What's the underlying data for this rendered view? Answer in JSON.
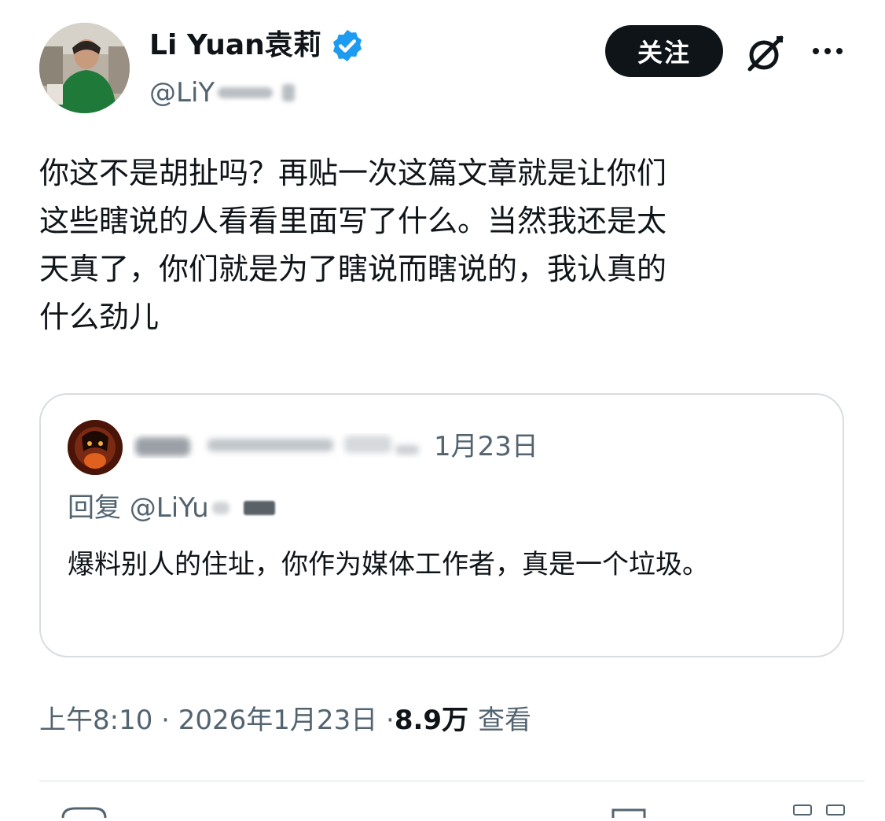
{
  "author": {
    "display_name": "Li Yuan袁莉",
    "handle_visible": "@LiY",
    "verified": true,
    "verified_color": "#1d9bf0"
  },
  "actions": {
    "follow_label": "关注",
    "grok_icon": "grok-icon",
    "more_icon": "more-icon"
  },
  "tweet": {
    "lines": [
      "你这不是胡扯吗？再贴一次这篇文章就是让你们",
      "这些瞎说的人看看里面写了什么。当然我还是太",
      "天真了，你们就是为了瞎说而瞎说的，我认真的",
      "什么劲儿"
    ]
  },
  "quote": {
    "date": "1月23日",
    "reply_prefix": "回复 @LiYu",
    "text": "爆料别人的住址，你作为媒体工作者，真是一个垃圾。"
  },
  "meta": {
    "time": "上午8:10 · 2026年1月23日 · ",
    "views_count": "8.9万",
    "views_label": "查看"
  },
  "colors": {
    "text": "#0f1419",
    "secondary": "#536471",
    "border": "#d8dde1",
    "follow_bg": "#0f1419"
  }
}
